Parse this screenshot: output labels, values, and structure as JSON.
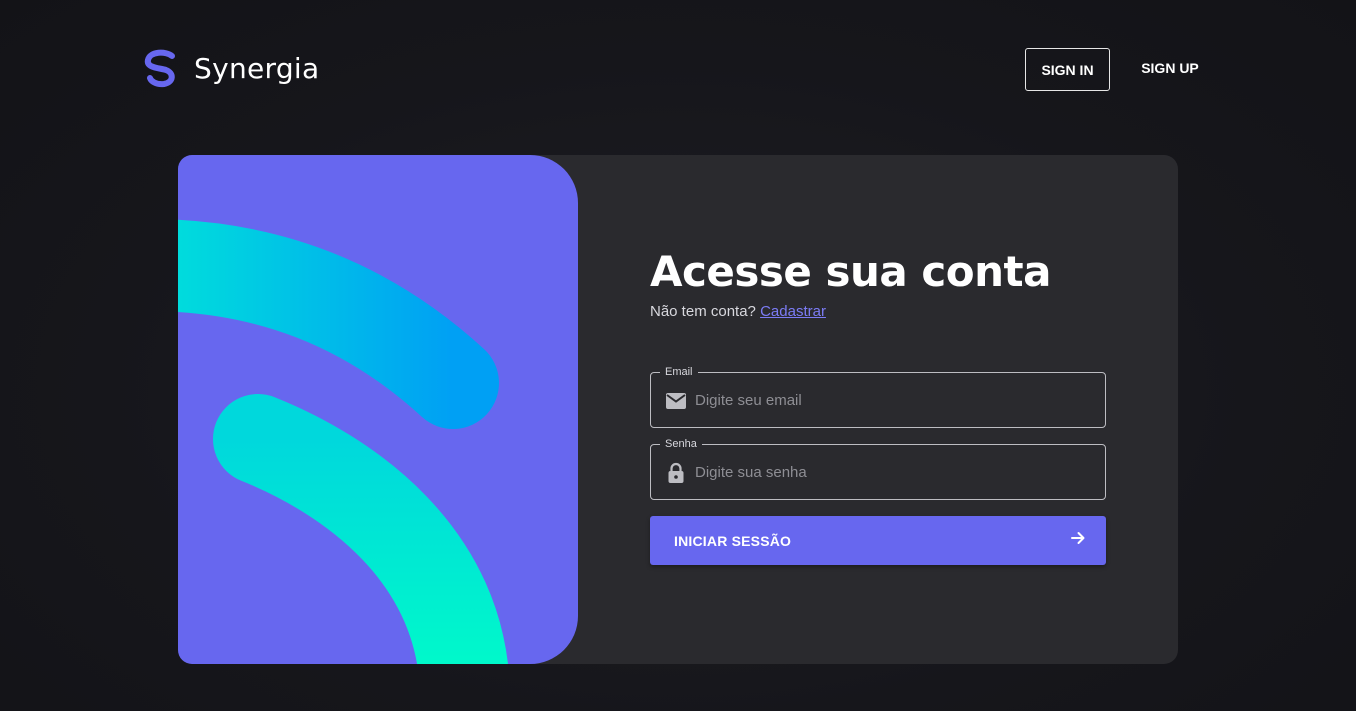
{
  "brand": {
    "name": "Synergia",
    "logo_icon": "synergia-s-logo-icon",
    "accent": "#6767ef"
  },
  "nav": {
    "signin_label": "SIGN IN",
    "signup_label": "SIGN UP"
  },
  "login": {
    "title": "Acesse sua conta",
    "no_account_text": "Não tem conta?",
    "register_link": "Cadastrar",
    "email": {
      "label": "Email",
      "placeholder": "Digite seu email",
      "value": "",
      "icon": "envelope-icon"
    },
    "password": {
      "label": "Senha",
      "placeholder": "Digite sua senha",
      "value": "",
      "icon": "lock-icon"
    },
    "submit_label": "INICIAR SESSÃO",
    "submit_icon": "arrow-right-icon"
  },
  "colors": {
    "background": "#16161b",
    "card": "#2a2a2e",
    "art_panel": "#6767ef",
    "stripe_blue": "#00a6f2",
    "stripe_teal": "#00f5cf"
  }
}
